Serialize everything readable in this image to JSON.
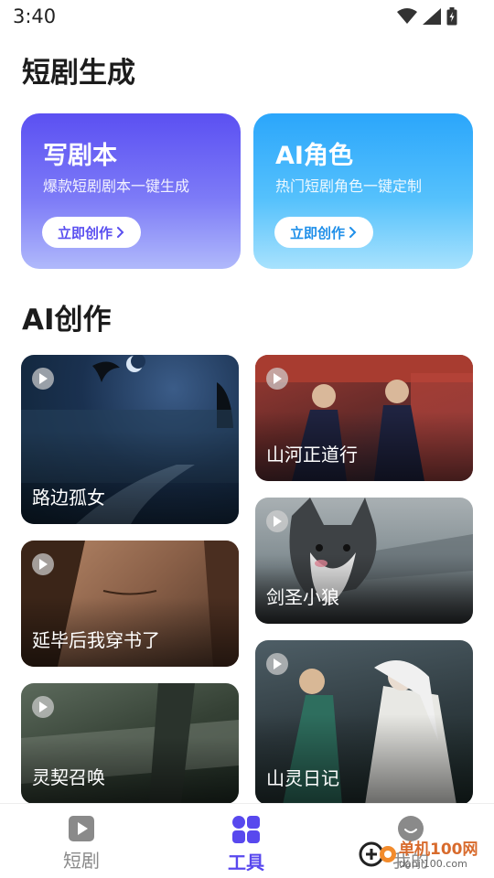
{
  "status_bar": {
    "time": "3:40"
  },
  "section_short_drama": {
    "title": "短剧生成"
  },
  "banners": [
    {
      "title": "写剧本",
      "subtitle": "爆款短剧剧本一键生成",
      "button": "立即创作"
    },
    {
      "title": "AI角色",
      "subtitle": "热门短剧角色一键定制",
      "button": "立即创作"
    }
  ],
  "section_ai": {
    "title": "AI创作"
  },
  "cards": [
    {
      "title": "路边孤女"
    },
    {
      "title": "延毕后我穿书了"
    },
    {
      "title": "灵契召唤"
    },
    {
      "title": "山河正道行"
    },
    {
      "title": "剑圣小狼"
    },
    {
      "title": "山灵日记"
    }
  ],
  "nav": {
    "home": "短剧",
    "tools": "工具",
    "mine": "我的"
  },
  "watermark": {
    "name": "单机100网",
    "url": "danji100.com"
  },
  "colors": {
    "accent": "#5848ee",
    "banner_left": "#5b50f2",
    "banner_right": "#2ba6fb"
  }
}
